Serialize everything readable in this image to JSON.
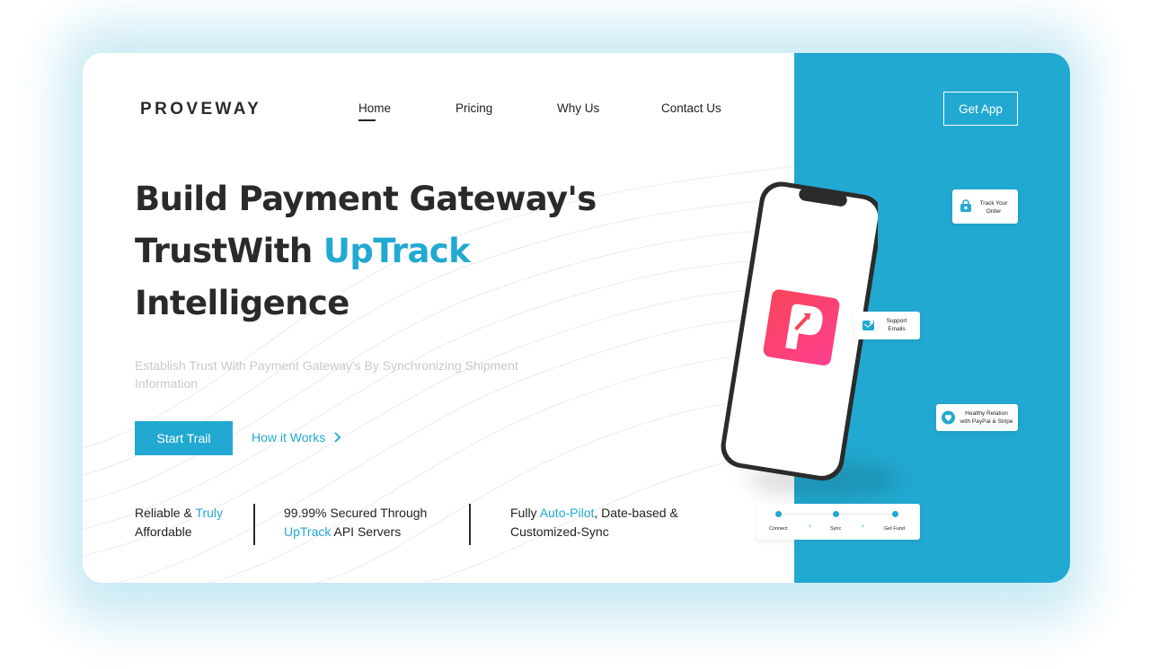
{
  "brand": {
    "logo": "PROVEWAY"
  },
  "nav": {
    "items": [
      "Home",
      "Pricing",
      "Why Us",
      "Contact Us"
    ],
    "active": "Home"
  },
  "header": {
    "cta": "Get App"
  },
  "hero": {
    "line1": "Build Payment Gateway's",
    "line2_plain": "TrustWith ",
    "line2_accent": "UpTrack",
    "line3": "Intelligence",
    "subtitle": "Establish Trust With Payment Gateway's By Synchronizing Shipment Information",
    "primary_button": "Start Trail",
    "secondary_link": "How it Works",
    "secondary_icon": "chevron-right-icon"
  },
  "features": [
    {
      "pre": "Reliable & ",
      "accent": "Truly",
      "post": "",
      "line2": "Affordable"
    },
    {
      "pre": "99.99% Secured Through",
      "accent": "UpTrack",
      "post": " API Servers"
    },
    {
      "pre": "Fully ",
      "accent": "Auto-Pilot",
      "post": ", Date-based &",
      "line2": "Customized-Sync"
    }
  ],
  "side_tags": {
    "track": {
      "icon": "lock-bag-icon",
      "line1": "Track Your",
      "line2": "Order"
    },
    "emails": {
      "icon": "mail-icon",
      "line1": "Support",
      "line2": "Emails"
    },
    "relation": {
      "icon": "heart-shield-icon",
      "line1": "Healthy Relation",
      "line2": "with PayPal & Stripe"
    },
    "steps": [
      "Connect",
      "Sync",
      "Get Fund"
    ]
  },
  "colors": {
    "accent": "#22a9d1",
    "app_icon_start": "#f7455a",
    "app_icon_end": "#ff3f8e",
    "text": "#2a2a2a"
  }
}
